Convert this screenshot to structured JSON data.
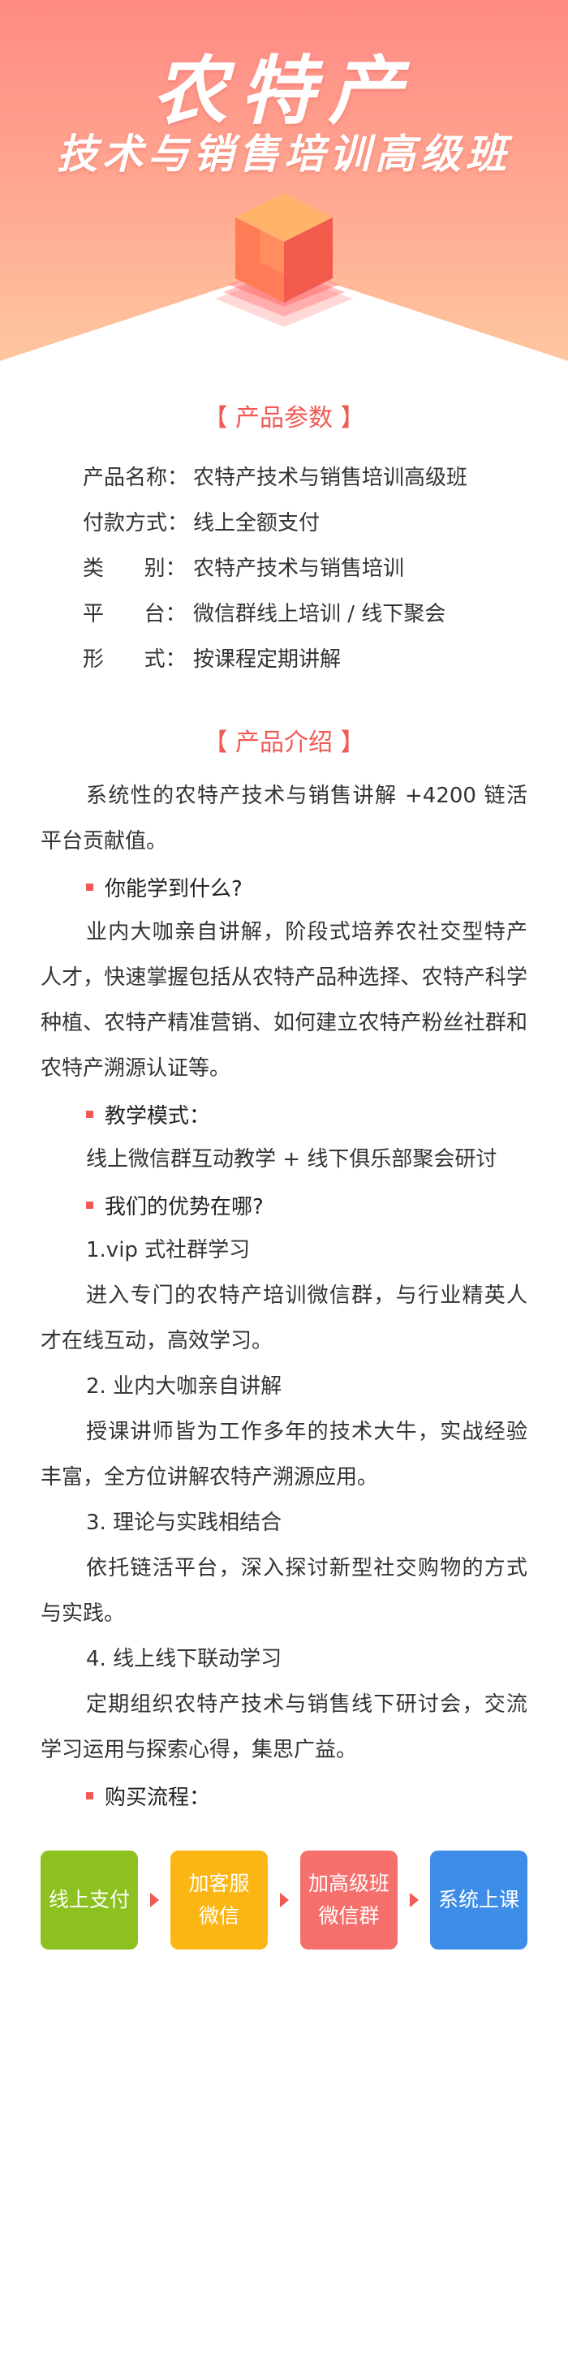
{
  "hero": {
    "title": "农特产",
    "subtitle": "技术与销售培训高级班"
  },
  "params": {
    "title": "【 产品参数 】",
    "rows": [
      {
        "key": "产品名称：",
        "value": "农特产技术与销售培训高级班"
      },
      {
        "key": "付款方式：",
        "value": "线上全额支付"
      },
      {
        "key": "类      别：",
        "value": "农特产技术与销售培训"
      },
      {
        "key": "平      台：",
        "value": "微信群线上培训 / 线下聚会"
      },
      {
        "key": "形      式：",
        "value": "按课程定期讲解"
      }
    ]
  },
  "intro": {
    "title": "【 产品介绍 】",
    "para1": "系统性的农特产技术与销售讲解 +4200 链活平台贡献值。",
    "bullet1": "你能学到什么?",
    "para2": "业内大咖亲自讲解，阶段式培养农社交型特产人才，快速掌握包括从农特产品种选择、农特产科学种植、农特产精准营销、如何建立农特产粉丝社群和农特产溯源认证等。",
    "bullet2": "教学模式：",
    "para3": "线上微信群互动教学 + 线下俱乐部聚会研讨",
    "bullet3": "我们的优势在哪?",
    "adv1_title": "1.vip 式社群学习",
    "adv1_text": "进入专门的农特产培训微信群，与行业精英人才在线互动，高效学习。",
    "adv2_title": "2. 业内大咖亲自讲解",
    "adv2_text": "授课讲师皆为工作多年的技术大牛，实战经验丰富，全方位讲解农特产溯源应用。",
    "adv3_title": "3. 理论与实践相结合",
    "adv3_text": "依托链活平台，深入探讨新型社交购物的方式与实践。",
    "adv4_title": "4. 线上线下联动学习",
    "adv4_text": "定期组织农特产技术与销售线下研讨会，交流学习运用与探索心得，集思广益。",
    "bullet4": "购买流程："
  },
  "process": {
    "steps": [
      {
        "label": "线上支付",
        "color": "#8cc11f"
      },
      {
        "label": "加客服\n微信",
        "color": "#fbb613"
      },
      {
        "label": "加高级班\n微信群",
        "color": "#f5706c"
      },
      {
        "label": "系统上课",
        "color": "#3d8de8"
      }
    ],
    "arrow_color": "#f05a55"
  },
  "colors": {
    "accent": "#f05a55",
    "hero_top": "#ff8a84",
    "hero_bottom": "#ffc7a0"
  }
}
